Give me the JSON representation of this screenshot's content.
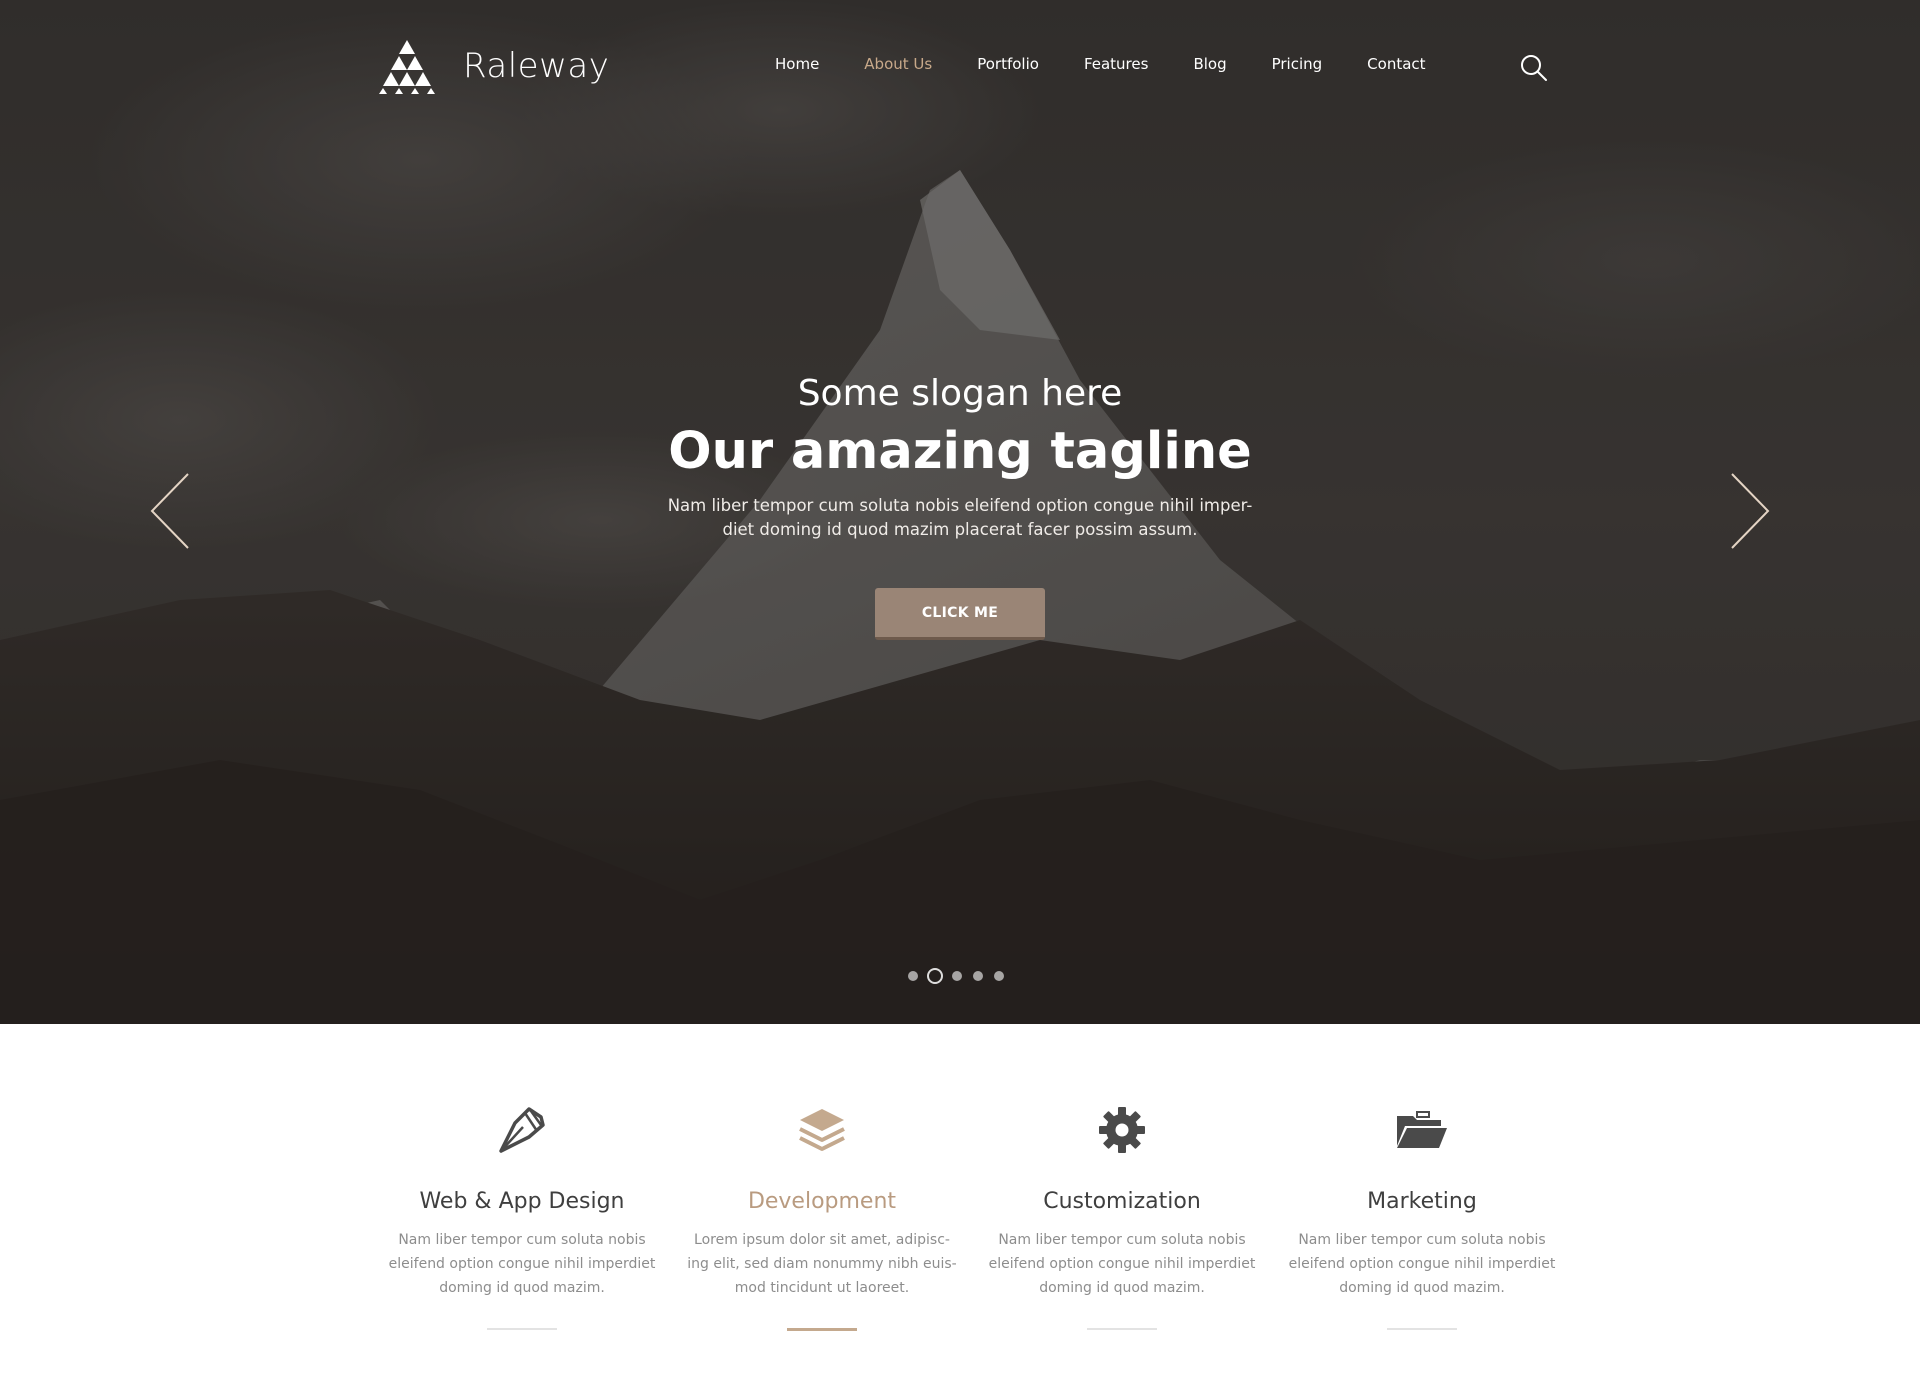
{
  "brand": {
    "name": "Raleway"
  },
  "nav": {
    "items": [
      {
        "label": "Home"
      },
      {
        "label": "About Us",
        "active": true
      },
      {
        "label": "Portfolio"
      },
      {
        "label": "Features"
      },
      {
        "label": "Blog"
      },
      {
        "label": "Pricing"
      },
      {
        "label": "Contact"
      }
    ]
  },
  "hero": {
    "slogan": "Some slogan here",
    "tagline": "Our amazing tagline",
    "description": "Nam liber tempor cum soluta nobis eleifend option congue nihil imper-diet doming id quod mazim placerat facer possim assum.",
    "button_label": "CLICK ME",
    "slides_total": 5,
    "active_slide": 2
  },
  "features": [
    {
      "icon": "pen-nib-icon",
      "title": "Web & App Design",
      "description": "Nam liber tempor cum soluta nobis eleifend option congue nihil imperdiet doming id quod mazim.",
      "active": false
    },
    {
      "icon": "layers-icon",
      "title": "Development",
      "description": "Lorem ipsum dolor sit amet, adipisc-ing elit, sed diam nonummy nibh euis-mod tincidunt ut laoreet.",
      "active": true
    },
    {
      "icon": "gear-icon",
      "title": "Customization",
      "description": "Nam liber tempor cum soluta nobis eleifend option congue nihil imperdiet doming id quod mazim.",
      "active": false
    },
    {
      "icon": "folder-open-icon",
      "title": "Marketing",
      "description": "Nam liber tempor cum soluta nobis eleifend option congue nihil imperdiet doming id quod mazim.",
      "active": false
    }
  ],
  "colors": {
    "accent": "#c8a98a",
    "button": "#9a8576",
    "feature_icon": "#4a4a4a",
    "feature_icon_active": "#c4a98e"
  }
}
